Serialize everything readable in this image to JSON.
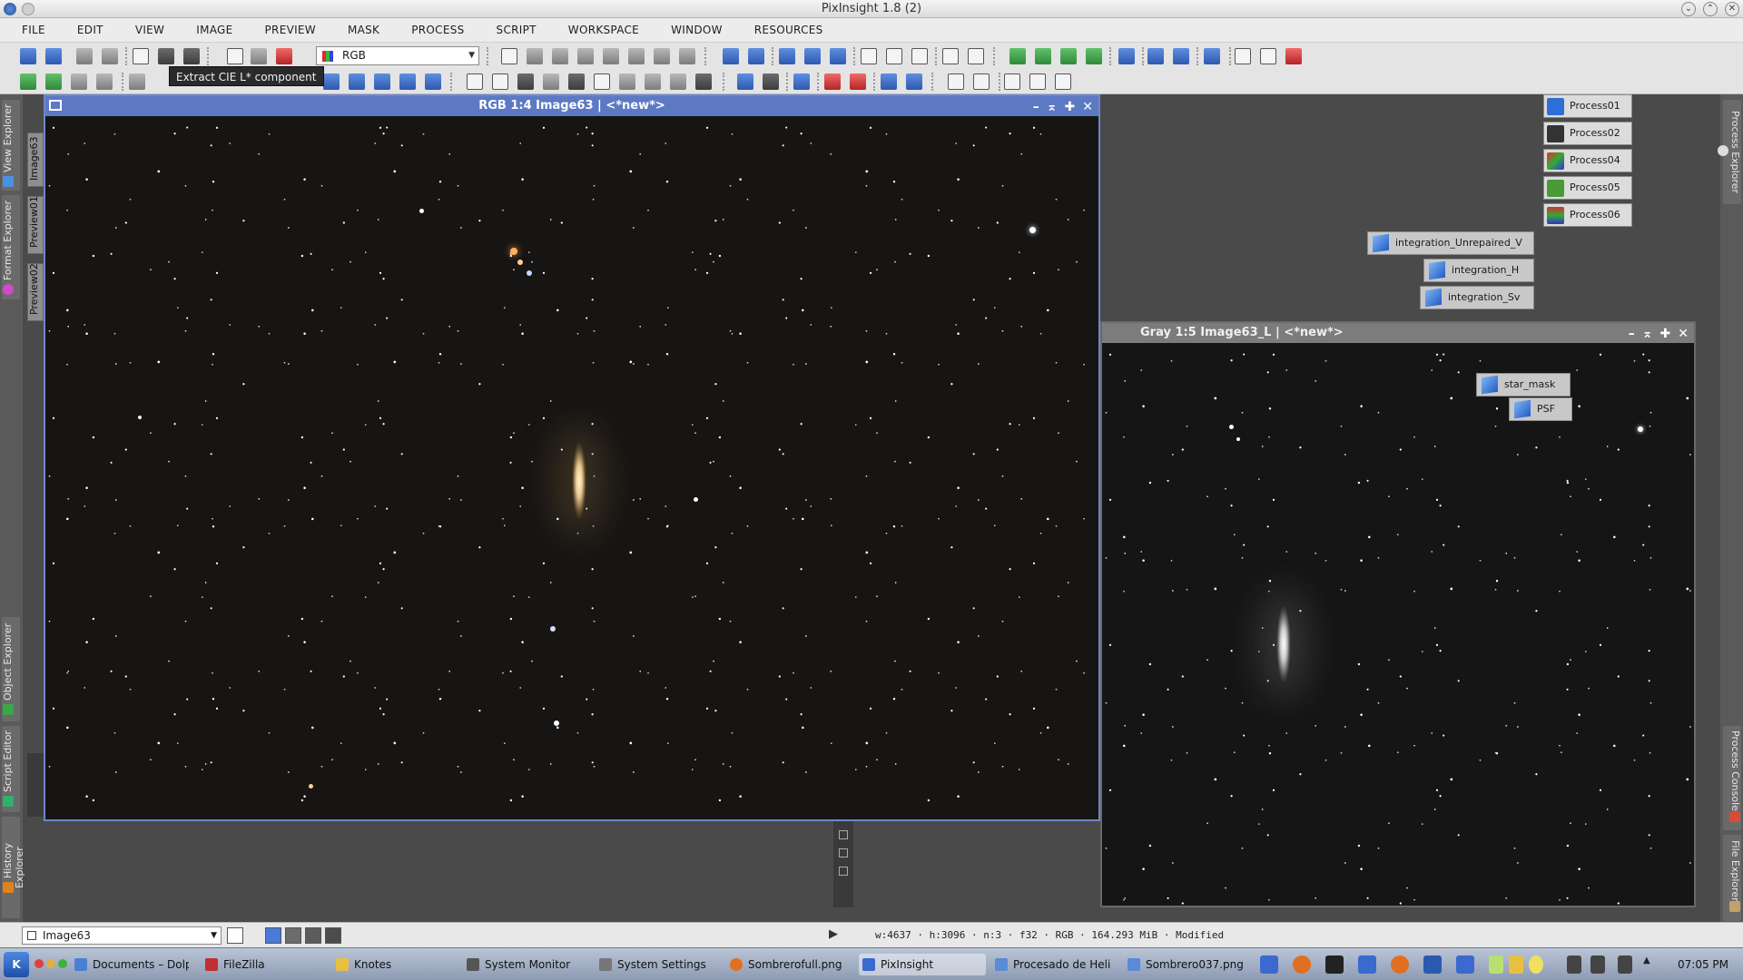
{
  "app": {
    "title": "PixInsight 1.8 (2)"
  },
  "menu": [
    "FILE",
    "EDIT",
    "VIEW",
    "IMAGE",
    "PREVIEW",
    "MASK",
    "PROCESS",
    "SCRIPT",
    "WORKSPACE",
    "WINDOW",
    "RESOURCES"
  ],
  "toolbar": {
    "channel_select": "RGB",
    "tooltip": "Extract CIE L* component"
  },
  "left_dock": [
    "View Explorer",
    "Format Explorer",
    "Object Explorer",
    "Script Editor",
    "History Explorer"
  ],
  "right_dock": [
    "Process Explorer",
    "Process Console",
    "File Explorer"
  ],
  "view_tabs": [
    "Image63",
    "Preview01",
    "Preview02"
  ],
  "windows": {
    "rgb": {
      "title": "RGB 1:4 Image63 | <*new*>"
    },
    "gray": {
      "title": "Gray 1:5 Image63_L | <*new*>"
    }
  },
  "process_icons": [
    "Process01",
    "Process02",
    "Process04",
    "Process05",
    "Process06"
  ],
  "image_icons": [
    "integration_Unrepaired_V",
    "integration_H",
    "integration_Sv",
    "star_mask",
    "PSF"
  ],
  "status": {
    "view_select": "Image63",
    "info": "w:4637 · h:3096 · n:3 · f32 · RGB · 164.293 MiB · Modified"
  },
  "taskbar": {
    "tasks": [
      "Documents – Dolph",
      "FileZilla",
      "Knotes",
      "System Monitor",
      "System Settings",
      "Sombrerofull.png",
      "PixInsight",
      "Procesado de Heli",
      "Sombrero037.png"
    ],
    "clock": "07:05 PM"
  }
}
